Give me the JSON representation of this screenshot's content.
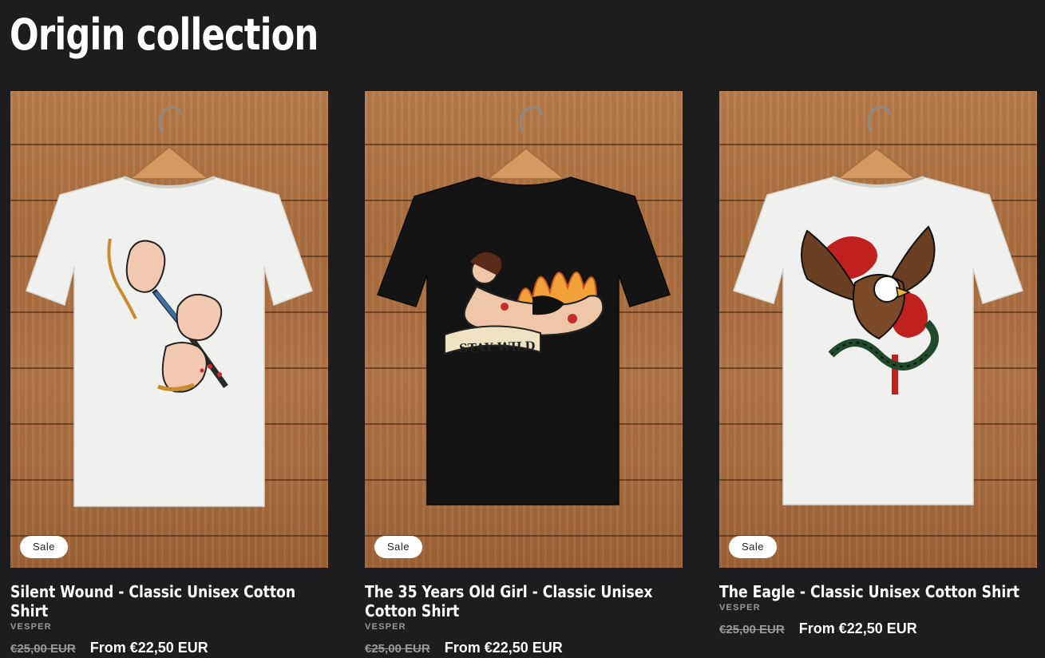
{
  "collection": {
    "title": "Origin collection"
  },
  "products": [
    {
      "title": "Silent Wound - Classic Unisex Cotton Shirt",
      "vendor": "VESPER",
      "badge": "Sale",
      "price_compare": "€25,00 EUR",
      "price": "From €22,50 EUR",
      "shirt_color": "#f0f0ee",
      "print": "dagger-hands"
    },
    {
      "title": "The 35 Years Old Girl - Classic Unisex Cotton Shirt",
      "vendor": "VESPER",
      "badge": "Sale",
      "price_compare": "€25,00 EUR",
      "price": "From €22,50 EUR",
      "shirt_color": "#141414",
      "print": "pinup-stay-wild",
      "print_text": "STAY WILD"
    },
    {
      "title": "The Eagle - Classic Unisex Cotton Shirt",
      "vendor": "VESPER",
      "badge": "Sale",
      "price_compare": "€25,00 EUR",
      "price": "From €22,50 EUR",
      "shirt_color": "#f0f0ee",
      "print": "eagle-snake"
    }
  ],
  "colors": {
    "background": "#1d1d1f",
    "text": "#ffffff",
    "muted": "#9a9a9a",
    "wood": "#ab6f41"
  }
}
